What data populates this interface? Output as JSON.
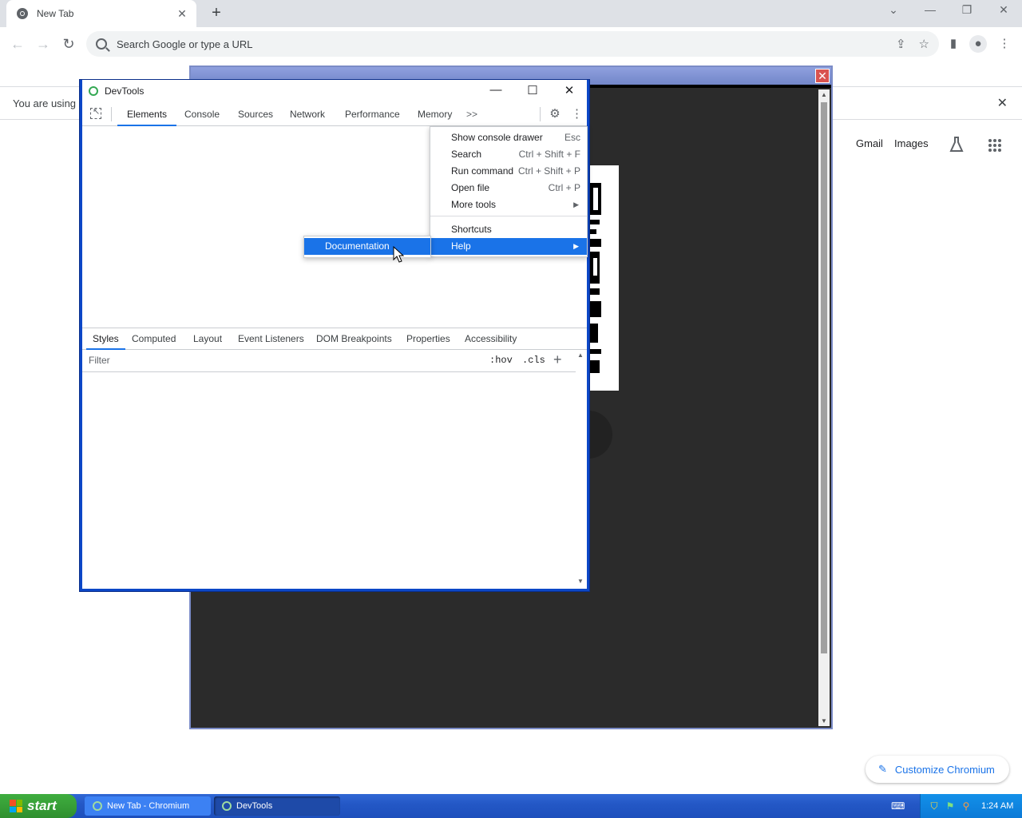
{
  "browser": {
    "tab_title": "New Tab",
    "omnibox_placeholder": "Search Google or type a URL",
    "infobar_text": "You are using a",
    "ntp_links": {
      "gmail": "Gmail",
      "images": "Images"
    },
    "customize_label": "Customize Chromium"
  },
  "devtools": {
    "window_title": "DevTools",
    "tabs": [
      {
        "label": "Elements",
        "active": true
      },
      {
        "label": "Console"
      },
      {
        "label": "Sources"
      },
      {
        "label": "Network"
      },
      {
        "label": "Performance"
      },
      {
        "label": "Memory"
      }
    ],
    "overflow_label": ">>",
    "subtabs": [
      {
        "label": "Styles",
        "active": true
      },
      {
        "label": "Computed"
      },
      {
        "label": "Layout"
      },
      {
        "label": "Event Listeners"
      },
      {
        "label": "DOM Breakpoints"
      },
      {
        "label": "Properties"
      },
      {
        "label": "Accessibility"
      }
    ],
    "filter_placeholder": "Filter",
    "hov_label": ":hov",
    "cls_label": ".cls"
  },
  "menu": {
    "items": [
      {
        "label": "Show console drawer",
        "shortcut": "Esc"
      },
      {
        "label": "Search",
        "shortcut": "Ctrl + Shift + F"
      },
      {
        "label": "Run command",
        "shortcut": "Ctrl + Shift + P"
      },
      {
        "label": "Open file",
        "shortcut": "Ctrl + P"
      },
      {
        "label": "More tools"
      },
      {
        "label": "Shortcuts"
      },
      {
        "label": "Help"
      }
    ],
    "submenu": {
      "label": "Documentation"
    }
  },
  "taskbar": {
    "start_label": "start",
    "items": [
      {
        "label": "New Tab - Chromium"
      },
      {
        "label": "DevTools"
      }
    ],
    "clock": "1:24 AM"
  },
  "colors": {
    "accent": "#1a73e8",
    "xp_taskbar": "#2458c6",
    "xp_start": "#3fae3f"
  }
}
